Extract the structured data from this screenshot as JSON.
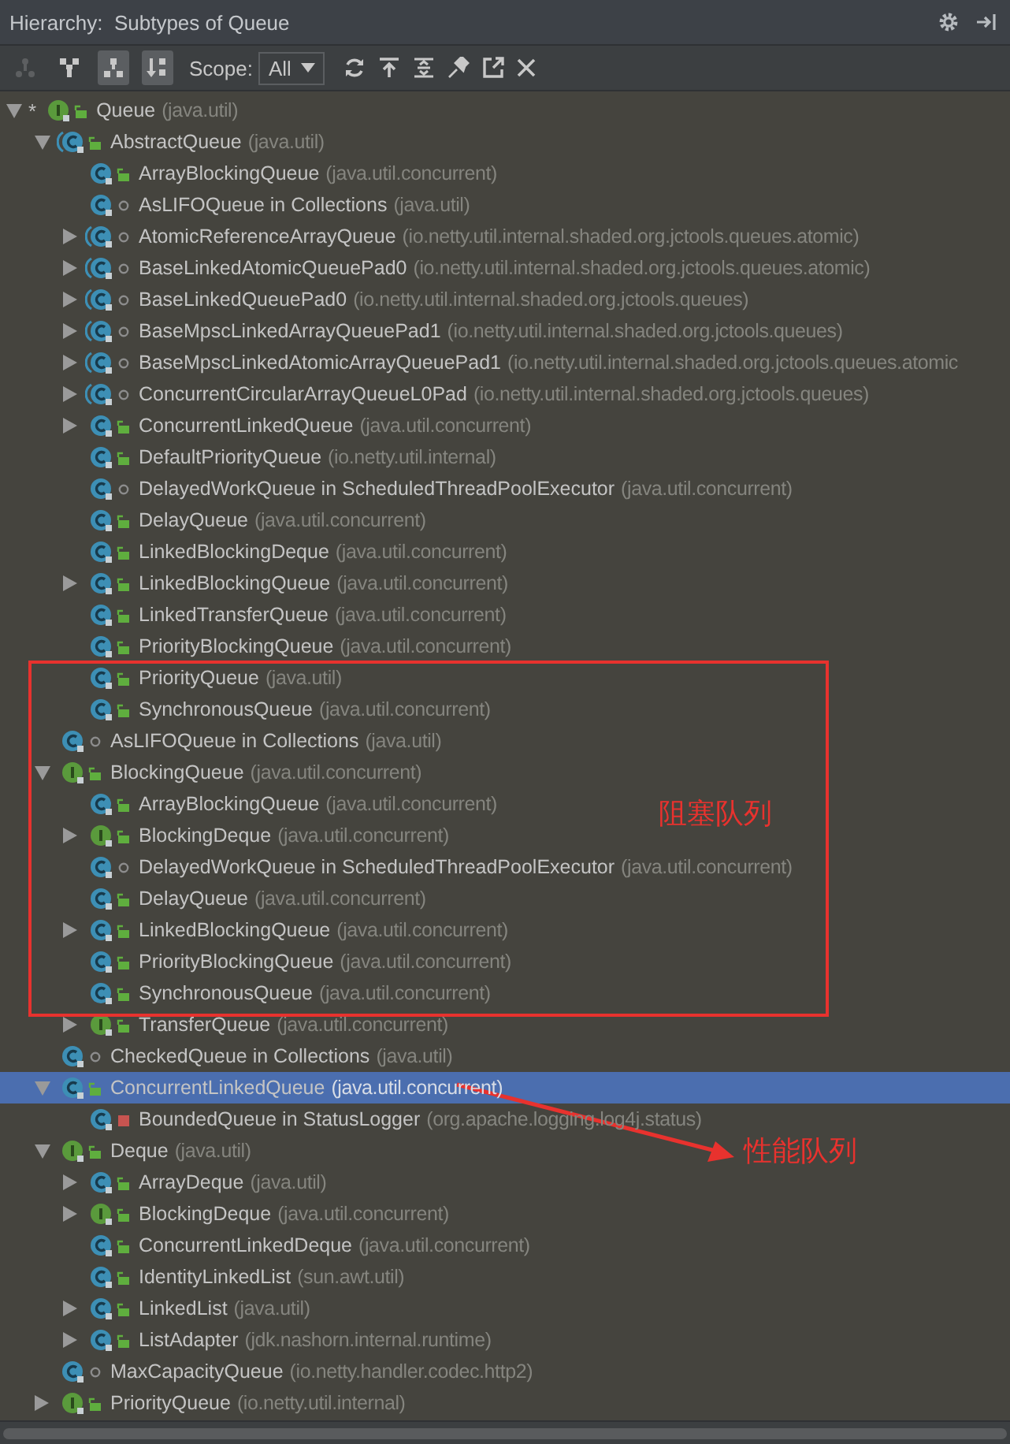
{
  "title": "Hierarchy:  Subtypes of Queue",
  "toolbar": {
    "view_buttons": [
      {
        "disabled": true,
        "pressed": false
      },
      {
        "disabled": false,
        "pressed": false
      },
      {
        "disabled": false,
        "pressed": true
      },
      {
        "disabled": false,
        "pressed": true
      }
    ],
    "scope_label": "Scope:",
    "scope_value": "All"
  },
  "tree": [
    {
      "name": "Queue",
      "package": "(java.util)",
      "marker": "*",
      "kind": "interface",
      "public": true,
      "private": false,
      "expanded": true,
      "selected": false,
      "children": [
        {
          "name": "AbstractQueue",
          "package": "(java.util)",
          "kind": "abstract",
          "public": true,
          "private": false,
          "expanded": true,
          "selected": false,
          "children": [
            {
              "name": "ArrayBlockingQueue",
              "package": "(java.util.concurrent)",
              "kind": "class",
              "public": true,
              "private": false,
              "selected": false
            },
            {
              "name": "AsLIFOQueue in Collections",
              "package": "(java.util)",
              "kind": "class",
              "public": false,
              "private": false,
              "selected": false
            },
            {
              "name": "AtomicReferenceArrayQueue",
              "package": "(io.netty.util.internal.shaded.org.jctools.queues.atomic)",
              "kind": "abstract",
              "public": false,
              "private": false,
              "expanded": false,
              "selected": false
            },
            {
              "name": "BaseLinkedAtomicQueuePad0",
              "package": "(io.netty.util.internal.shaded.org.jctools.queues.atomic)",
              "kind": "abstract",
              "public": false,
              "private": false,
              "expanded": false,
              "selected": false
            },
            {
              "name": "BaseLinkedQueuePad0",
              "package": "(io.netty.util.internal.shaded.org.jctools.queues)",
              "kind": "abstract",
              "public": false,
              "private": false,
              "expanded": false,
              "selected": false
            },
            {
              "name": "BaseMpscLinkedArrayQueuePad1",
              "package": "(io.netty.util.internal.shaded.org.jctools.queues)",
              "kind": "abstract",
              "public": false,
              "private": false,
              "expanded": false,
              "selected": false
            },
            {
              "name": "BaseMpscLinkedAtomicArrayQueuePad1",
              "package": "(io.netty.util.internal.shaded.org.jctools.queues.atomic",
              "kind": "abstract",
              "public": false,
              "private": false,
              "expanded": false,
              "selected": false
            },
            {
              "name": "ConcurrentCircularArrayQueueL0Pad",
              "package": "(io.netty.util.internal.shaded.org.jctools.queues)",
              "kind": "abstract",
              "public": false,
              "private": false,
              "expanded": false,
              "selected": false
            },
            {
              "name": "ConcurrentLinkedQueue",
              "package": "(java.util.concurrent)",
              "kind": "class",
              "public": true,
              "private": false,
              "expanded": false,
              "selected": false
            },
            {
              "name": "DefaultPriorityQueue",
              "package": "(io.netty.util.internal)",
              "kind": "class",
              "public": true,
              "private": false,
              "selected": false
            },
            {
              "name": "DelayedWorkQueue in ScheduledThreadPoolExecutor",
              "package": "(java.util.concurrent)",
              "kind": "class",
              "public": false,
              "private": false,
              "selected": false
            },
            {
              "name": "DelayQueue",
              "package": "(java.util.concurrent)",
              "kind": "class",
              "public": true,
              "private": false,
              "selected": false
            },
            {
              "name": "LinkedBlockingDeque",
              "package": "(java.util.concurrent)",
              "kind": "class",
              "public": true,
              "private": false,
              "selected": false
            },
            {
              "name": "LinkedBlockingQueue",
              "package": "(java.util.concurrent)",
              "kind": "class",
              "public": true,
              "private": false,
              "expanded": false,
              "selected": false
            },
            {
              "name": "LinkedTransferQueue",
              "package": "(java.util.concurrent)",
              "kind": "class",
              "public": true,
              "private": false,
              "selected": false
            },
            {
              "name": "PriorityBlockingQueue",
              "package": "(java.util.concurrent)",
              "kind": "class",
              "public": true,
              "private": false,
              "selected": false
            },
            {
              "name": "PriorityQueue",
              "package": "(java.util)",
              "kind": "class",
              "public": true,
              "private": false,
              "selected": false
            },
            {
              "name": "SynchronousQueue",
              "package": "(java.util.concurrent)",
              "kind": "class",
              "public": true,
              "private": false,
              "selected": false
            }
          ]
        },
        {
          "name": "AsLIFOQueue in Collections",
          "package": "(java.util)",
          "kind": "class",
          "public": false,
          "private": false,
          "selected": false
        },
        {
          "name": "BlockingQueue",
          "package": "(java.util.concurrent)",
          "kind": "interface",
          "public": true,
          "private": false,
          "expanded": true,
          "selected": false,
          "children": [
            {
              "name": "ArrayBlockingQueue",
              "package": "(java.util.concurrent)",
              "kind": "class",
              "public": true,
              "private": false,
              "selected": false
            },
            {
              "name": "BlockingDeque",
              "package": "(java.util.concurrent)",
              "kind": "interface",
              "public": true,
              "private": false,
              "expanded": false,
              "selected": false
            },
            {
              "name": "DelayedWorkQueue in ScheduledThreadPoolExecutor",
              "package": "(java.util.concurrent)",
              "kind": "class",
              "public": false,
              "private": false,
              "selected": false
            },
            {
              "name": "DelayQueue",
              "package": "(java.util.concurrent)",
              "kind": "class",
              "public": true,
              "private": false,
              "selected": false
            },
            {
              "name": "LinkedBlockingQueue",
              "package": "(java.util.concurrent)",
              "kind": "class",
              "public": true,
              "private": false,
              "expanded": false,
              "selected": false
            },
            {
              "name": "PriorityBlockingQueue",
              "package": "(java.util.concurrent)",
              "kind": "class",
              "public": true,
              "private": false,
              "selected": false
            },
            {
              "name": "SynchronousQueue",
              "package": "(java.util.concurrent)",
              "kind": "class",
              "public": true,
              "private": false,
              "selected": false
            },
            {
              "name": "TransferQueue",
              "package": "(java.util.concurrent)",
              "kind": "interface",
              "public": true,
              "private": false,
              "expanded": false,
              "selected": false
            }
          ]
        },
        {
          "name": "CheckedQueue in Collections",
          "package": "(java.util)",
          "kind": "class",
          "public": false,
          "private": false,
          "selected": false
        },
        {
          "name": "ConcurrentLinkedQueue",
          "package": "(java.util.concurrent)",
          "kind": "class",
          "public": true,
          "private": false,
          "expanded": true,
          "selected": true,
          "children": [
            {
              "name": "BoundedQueue in StatusLogger",
              "package": "(org.apache.logging.log4j.status)",
              "kind": "class",
              "public": false,
              "private": true,
              "selected": false
            }
          ]
        },
        {
          "name": "Deque",
          "package": "(java.util)",
          "kind": "interface",
          "public": true,
          "private": false,
          "expanded": true,
          "selected": false,
          "children": [
            {
              "name": "ArrayDeque",
              "package": "(java.util)",
              "kind": "class",
              "public": true,
              "private": false,
              "expanded": false,
              "selected": false
            },
            {
              "name": "BlockingDeque",
              "package": "(java.util.concurrent)",
              "kind": "interface",
              "public": true,
              "private": false,
              "expanded": false,
              "selected": false
            },
            {
              "name": "ConcurrentLinkedDeque",
              "package": "(java.util.concurrent)",
              "kind": "class",
              "public": true,
              "private": false,
              "selected": false
            },
            {
              "name": "IdentityLinkedList",
              "package": "(sun.awt.util)",
              "kind": "class",
              "public": true,
              "private": false,
              "selected": false
            },
            {
              "name": "LinkedList",
              "package": "(java.util)",
              "kind": "class",
              "public": true,
              "private": false,
              "expanded": false,
              "selected": false
            },
            {
              "name": "ListAdapter",
              "package": "(jdk.nashorn.internal.runtime)",
              "kind": "class",
              "public": true,
              "private": false,
              "expanded": false,
              "selected": false
            }
          ]
        },
        {
          "name": "MaxCapacityQueue",
          "package": "(io.netty.handler.codec.http2)",
          "kind": "class",
          "public": false,
          "private": false,
          "selected": false
        },
        {
          "name": "PriorityQueue",
          "package": "(io.netty.util.internal)",
          "kind": "interface",
          "public": true,
          "private": false,
          "expanded": false,
          "selected": false
        }
      ]
    }
  ],
  "annotations": {
    "blocking_box": {
      "label": "阻塞队列"
    },
    "performance_arrow": {
      "label": "性能队列"
    }
  }
}
